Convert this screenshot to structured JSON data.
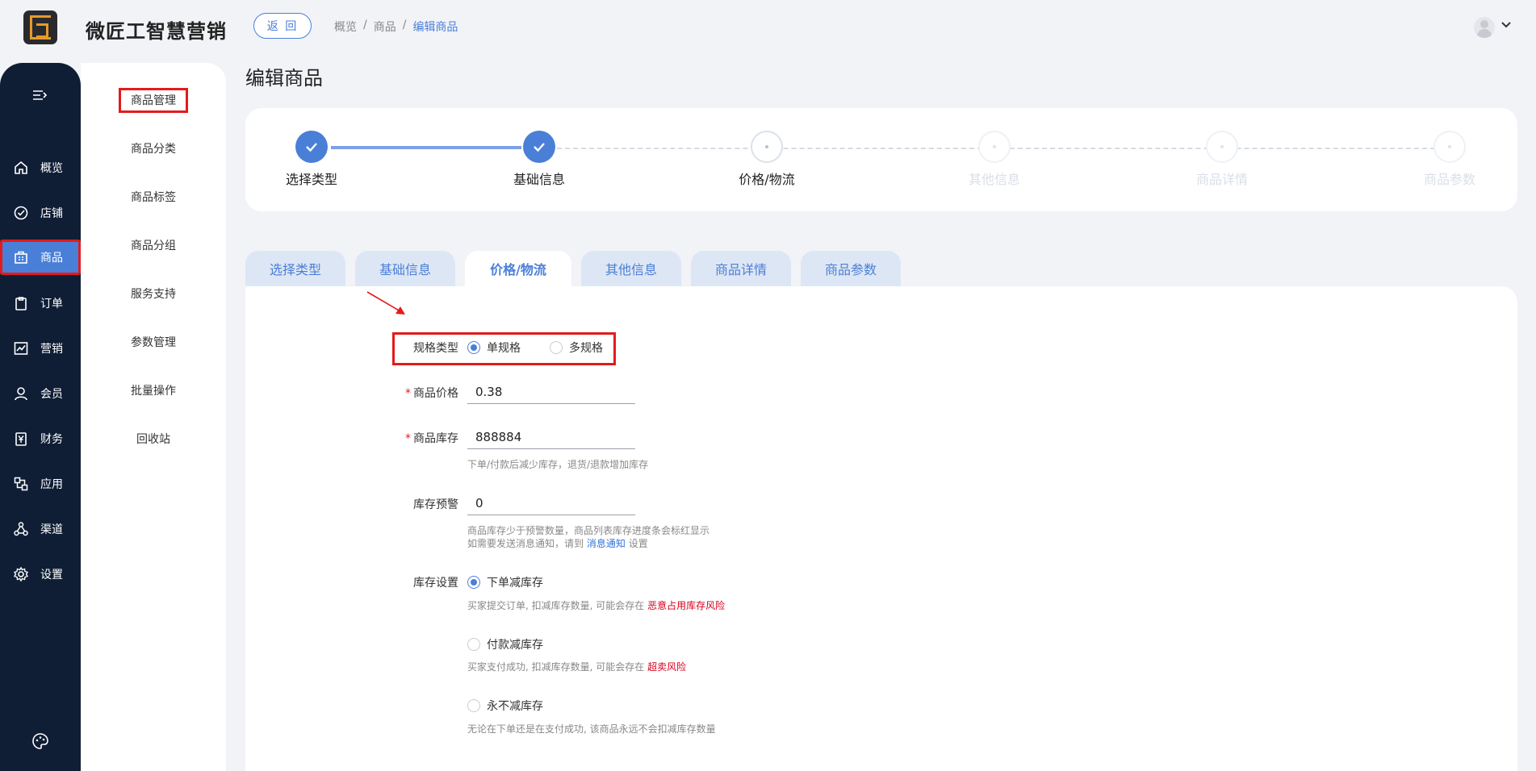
{
  "header": {
    "brand": "微匠工智慧营销",
    "back_label": "返 回",
    "breadcrumb": [
      "概览",
      "/",
      "商品",
      "/",
      "编辑商品"
    ]
  },
  "nav": {
    "items": [
      {
        "label": "概览",
        "icon": "home-icon"
      },
      {
        "label": "店铺",
        "icon": "shop-check-icon"
      },
      {
        "label": "商品",
        "icon": "product-bag-icon"
      },
      {
        "label": "订单",
        "icon": "clipboard-icon"
      },
      {
        "label": "营销",
        "icon": "chart-icon"
      },
      {
        "label": "会员",
        "icon": "user-icon"
      },
      {
        "label": "财务",
        "icon": "yen-icon"
      },
      {
        "label": "应用",
        "icon": "apps-icon"
      },
      {
        "label": "渠道",
        "icon": "channel-icon"
      },
      {
        "label": "设置",
        "icon": "gear-icon"
      }
    ],
    "active": "商品"
  },
  "subnav": {
    "items": [
      "商品管理",
      "商品分类",
      "商品标签",
      "商品分组",
      "服务支持",
      "参数管理",
      "批量操作",
      "回收站"
    ]
  },
  "page_title": "编辑商品",
  "steps": [
    {
      "label": "选择类型",
      "status": "done"
    },
    {
      "label": "基础信息",
      "status": "done"
    },
    {
      "label": "价格/物流",
      "status": "current"
    },
    {
      "label": "其他信息",
      "status": "upcoming"
    },
    {
      "label": "商品详情",
      "status": "upcoming"
    },
    {
      "label": "商品参数",
      "status": "upcoming"
    }
  ],
  "tabs": [
    "选择类型",
    "基础信息",
    "价格/物流",
    "其他信息",
    "商品详情",
    "商品参数"
  ],
  "active_tab": "价格/物流",
  "form": {
    "spec_type": {
      "label": "规格类型",
      "options": [
        "单规格",
        "多规格"
      ],
      "selected": "单规格"
    },
    "price": {
      "label": "商品价格",
      "value": "0.38"
    },
    "stock": {
      "label": "商品库存",
      "value": "888884",
      "hint": "下单/付款后减少库存，退货/退款增加库存"
    },
    "stock_warning": {
      "label": "库存预警",
      "value": "0",
      "hint1": "商品库存少于预警数量，商品列表库存进度条会标红显示",
      "hint2_prefix": "如需要发送消息通知，请到",
      "hint2_link": "消息通知",
      "hint2_suffix": "设置"
    },
    "stock_setting": {
      "label": "库存设置",
      "selected": "下单减库存",
      "options": [
        {
          "label": "下单减库存",
          "hint": "买家提交订单, 扣减库存数量, 可能会存在",
          "risk": "恶意占用库存风险"
        },
        {
          "label": "付款减库存",
          "hint": "买家支付成功, 扣减库存数量, 可能会存在",
          "risk": "超卖风险"
        },
        {
          "label": "永不减库存",
          "hint": "无论在下单还是在支付成功, 该商品永远不会扣减库存数量",
          "risk": ""
        }
      ]
    }
  },
  "colors": {
    "primary": "#4a7fd8",
    "nav_bg": "#0f1e35",
    "annotation_red": "#e31b1b"
  }
}
